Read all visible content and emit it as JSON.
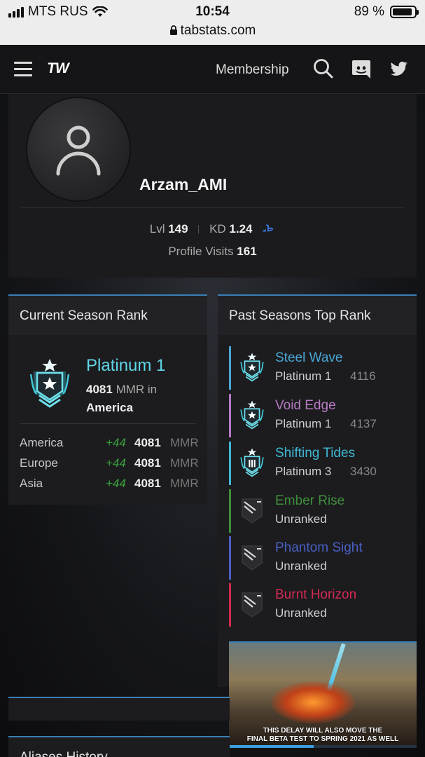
{
  "status_bar": {
    "carrier": "MTS RUS",
    "time": "10:54",
    "battery": "89 %",
    "battery_level": 0.89
  },
  "browser": {
    "url": "tabstats.com"
  },
  "nav": {
    "logo": "TW",
    "membership": "Membership"
  },
  "profile": {
    "username": "Arzam_AMI",
    "level_label": "Lvl",
    "level": "149",
    "kd_label": "KD",
    "kd": "1.24",
    "visits_label": "Profile Visits",
    "visits": "161"
  },
  "current_season": {
    "title": "Current Season Rank",
    "rank": "Platinum 1",
    "mmr": "4081",
    "mmr_suffix": "MMR in",
    "region": "America",
    "regions": [
      {
        "name": "America",
        "delta": "+44",
        "mmr": "4081",
        "unit": "MMR"
      },
      {
        "name": "Europe",
        "delta": "+44",
        "mmr": "4081",
        "unit": "MMR"
      },
      {
        "name": "Asia",
        "delta": "+44",
        "mmr": "4081",
        "unit": "MMR"
      }
    ]
  },
  "past_seasons": {
    "title": "Past Seasons Top Rank",
    "items": [
      {
        "name": "Steel Wave",
        "rank": "Platinum 1",
        "mmr": "4116",
        "color": "#4aa7d4",
        "icon": "platinum-1-icon"
      },
      {
        "name": "Void Edge",
        "rank": "Platinum 1",
        "mmr": "4137",
        "color": "#b77ac2",
        "icon": "platinum-1-icon"
      },
      {
        "name": "Shifting Tides",
        "rank": "Platinum 3",
        "mmr": "3430",
        "color": "#3fb8d4",
        "icon": "platinum-3-icon"
      },
      {
        "name": "Ember Rise",
        "rank": "Unranked",
        "mmr": "",
        "color": "#3e8f3a",
        "icon": "unranked-icon"
      },
      {
        "name": "Phantom Sight",
        "rank": "Unranked",
        "mmr": "",
        "color": "#4a5fc4",
        "icon": "unranked-icon"
      },
      {
        "name": "Burnt Horizon",
        "rank": "Unranked",
        "mmr": "",
        "color": "#d42a52",
        "icon": "unranked-icon"
      }
    ]
  },
  "ad": {
    "caption_line1": "THIS DELAY WILL ALSO MOVE THE",
    "caption_line2": "FINAL BETA TEST TO SPRING 2021 AS WELL",
    "progress": 0.45
  },
  "aliases": {
    "title": "Aliases History"
  },
  "colors": {
    "accent": "#3a7fb5",
    "rank_text": "#5fd6e6",
    "positive": "#3aa23a"
  }
}
